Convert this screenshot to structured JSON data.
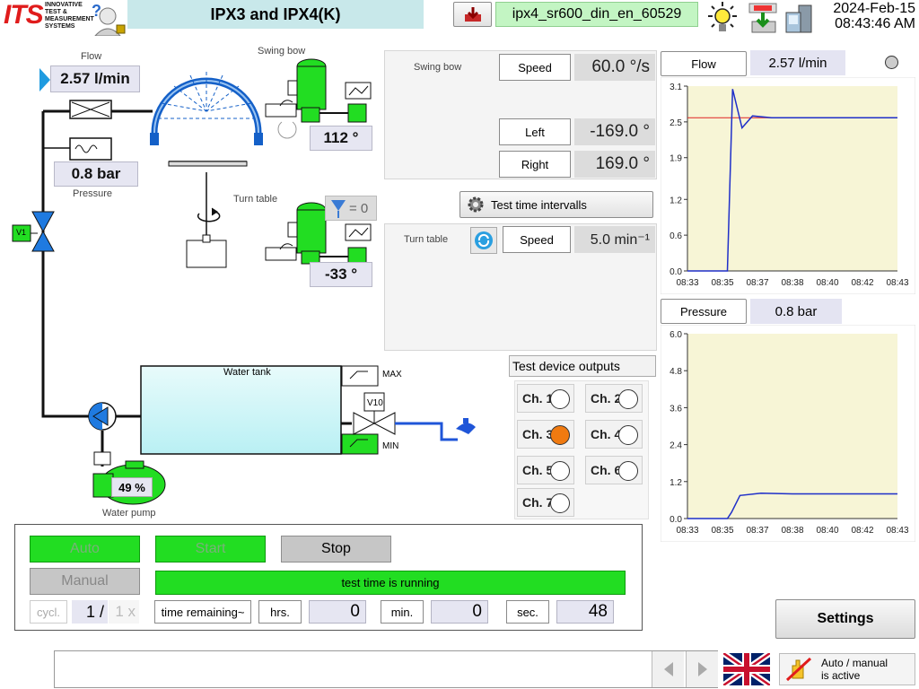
{
  "header": {
    "logo_text": "ITS",
    "logo_tagline": "INNOVATIVE TEST & MEASUREMENT SYSTEMS",
    "title": "IPX3 and IPX4(K)",
    "program_name": "ipx4_sr600_din_en_60529",
    "date": "2024-Feb-15",
    "time": "08:43:46 AM"
  },
  "diagram": {
    "flow_label": "Flow",
    "flow_value": "2.57 l/min",
    "pressure_value": "0.8 bar",
    "pressure_label": "Pressure",
    "swing_bow_label": "Swing bow",
    "swing_bow_angle": "112 °",
    "turn_table_label": "Turn table",
    "turn_table_angle": "-33 °",
    "valve_v1": "V1",
    "valve_v10": "V10",
    "nozzle_counter": "= 0",
    "water_tank_label": "Water tank",
    "max_label": "MAX",
    "min_label": "MIN",
    "pump_percent": "49 %",
    "water_pump_label": "Water pump"
  },
  "swing_bow_panel": {
    "title": "Swing bow",
    "speed_label": "Speed",
    "speed_value": "60.0 °/s",
    "left_label": "Left",
    "left_value": "-169.0 °",
    "right_label": "Right",
    "right_value": "169.0 °"
  },
  "test_time_button": "Test time intervalls",
  "turn_table_panel": {
    "title": "Turn table",
    "speed_label": "Speed",
    "speed_value": "5.0 min⁻¹"
  },
  "outputs": {
    "title": "Test device outputs",
    "channels": [
      {
        "label": "Ch. 1",
        "active": false
      },
      {
        "label": "Ch. 2",
        "active": false
      },
      {
        "label": "Ch. 3",
        "active": true
      },
      {
        "label": "Ch. 4",
        "active": false
      },
      {
        "label": "Ch. 5",
        "active": false
      },
      {
        "label": "Ch. 6",
        "active": false
      },
      {
        "label": "Ch. 7",
        "active": false
      }
    ],
    "active_color": "#f07a10"
  },
  "flow_chart_header": {
    "button": "Flow",
    "value": "2.57 l/min"
  },
  "pressure_chart_header": {
    "button": "Pressure",
    "value": "0.8 bar"
  },
  "chart_data": [
    {
      "type": "line",
      "title": "",
      "x": [
        "08:33",
        "08:35",
        "08:37",
        "08:38",
        "08:40",
        "08:42",
        "08:43"
      ],
      "yticks": [
        "0.0",
        "0.6",
        "1.2",
        "1.9",
        "2.5",
        "3.1"
      ],
      "ylim": [
        0,
        3.1
      ],
      "setpoint": 2.57,
      "series": [
        {
          "values": [
            0.0,
            0.0,
            3.05,
            2.4,
            2.6,
            2.57,
            2.57,
            2.57,
            2.57,
            2.57
          ],
          "t": [
            0,
            0.19,
            0.215,
            0.26,
            0.31,
            0.4,
            0.55,
            0.7,
            0.85,
            1.0
          ]
        }
      ],
      "colors": {
        "line": "#1f2fc9",
        "setpoint": "#e02020",
        "background": "#f7f5d6"
      }
    },
    {
      "type": "line",
      "title": "",
      "x": [
        "08:33",
        "08:35",
        "08:37",
        "08:38",
        "08:40",
        "08:42",
        "08:43"
      ],
      "yticks": [
        "0.0",
        "1.2",
        "2.4",
        "3.6",
        "4.8",
        "6.0"
      ],
      "ylim": [
        0,
        6.0
      ],
      "series": [
        {
          "values": [
            0.0,
            0.0,
            0.2,
            0.75,
            0.82,
            0.8,
            0.8,
            0.8
          ],
          "t": [
            0,
            0.19,
            0.21,
            0.25,
            0.35,
            0.5,
            0.75,
            1.0
          ]
        }
      ],
      "colors": {
        "line": "#1f2fc9",
        "background": "#f7f5d6"
      }
    }
  ],
  "control": {
    "auto": "Auto",
    "start": "Start",
    "stop": "Stop",
    "manual": "Manual",
    "status": "test time is running",
    "cycl_label": "cycl.",
    "cycle_current": "1 /",
    "cycle_total": "1 x",
    "time_mode": "time remaining~",
    "hrs_label": "hrs.",
    "hrs_value": "0",
    "min_label": "min.",
    "min_value": "0",
    "sec_label": "sec.",
    "sec_value": "48"
  },
  "settings_button": "Settings",
  "footer": {
    "message": "",
    "mode_status": "Auto / manual\nis active"
  }
}
